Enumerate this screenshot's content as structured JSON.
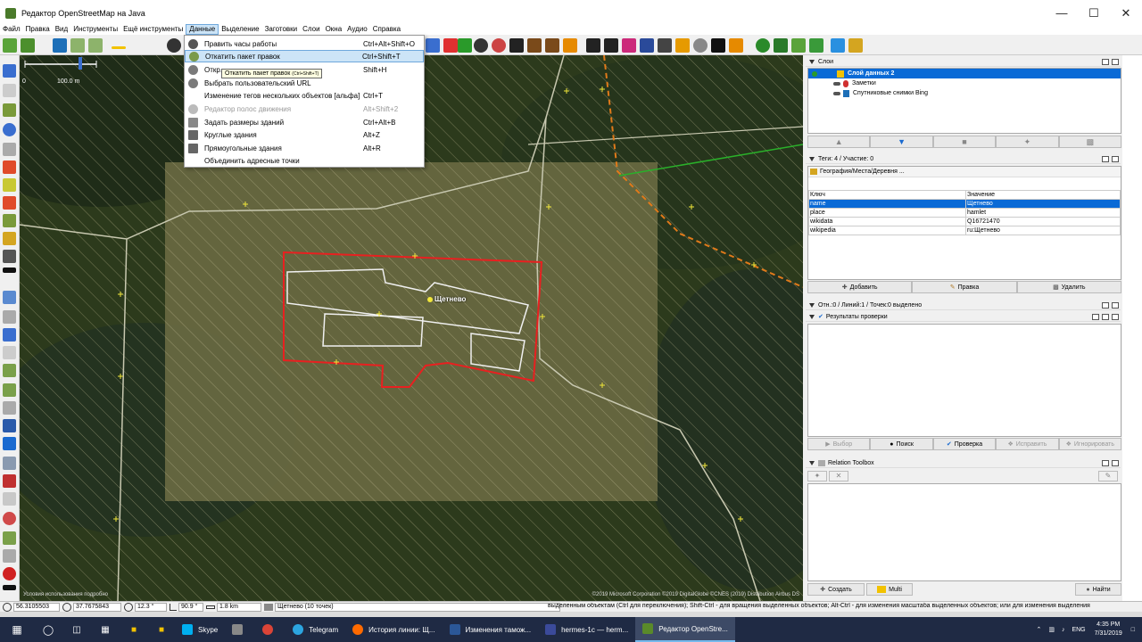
{
  "window": {
    "title": "Редактор OpenStreetMap на Java"
  },
  "menubar": [
    "Файл",
    "Правка",
    "Вид",
    "Инструменты",
    "Ещё инструменты",
    "Данные",
    "Выделение",
    "Заготовки",
    "Слои",
    "Окна",
    "Аудио",
    "Справка"
  ],
  "active_menu": "Данные",
  "dropdown": [
    {
      "label": "Править часы работы",
      "shortcut": "Ctrl+Alt+Shift+O",
      "icon": "clock-icon",
      "disabled": false
    },
    {
      "label": "Откатить пакет правок",
      "shortcut": "Ctrl+Shift+T",
      "icon": "revert-icon",
      "disabled": false,
      "highlighted": true
    },
    {
      "label": "Откр...",
      "shortcut": "Shift+H",
      "icon": "history-icon",
      "disabled": false
    },
    {
      "label": "Выбрать пользовательский URL",
      "shortcut": "",
      "icon": "url-icon",
      "disabled": false
    },
    {
      "label": "Изменение тегов нескольких объектов [альфа]",
      "shortcut": "Ctrl+T",
      "icon": "tags-icon",
      "disabled": false
    },
    {
      "label": "Редактор полос движения",
      "shortcut": "Alt+Shift+2",
      "icon": "lanes-icon",
      "disabled": true
    },
    {
      "label": "Задать размеры зданий",
      "shortcut": "Ctrl+Alt+B",
      "icon": "building-icon",
      "disabled": false
    },
    {
      "label": "Круглые здания",
      "shortcut": "Alt+Z",
      "icon": "circle-building-icon",
      "disabled": false
    },
    {
      "label": "Прямоугольные здания",
      "shortcut": "Alt+R",
      "icon": "rect-building-icon",
      "disabled": false
    },
    {
      "label": "Объединить адресные точки",
      "shortcut": "",
      "icon": "merge-address-icon",
      "disabled": false
    }
  ],
  "tooltip": "Откатить пакет правок",
  "tooltip_shortcut": "(Ctrl+Shift+T)",
  "map": {
    "scale_zero": "0",
    "scale_label": "100.0 m",
    "place_label": "Щетнево",
    "attribution_left": "Условия использования подробно",
    "attribution_right": "©2019 Microsoft Corporation ©2019 DigitalGlobe ©CNES (2019) Distribution Airbus DS"
  },
  "layers_panel": {
    "title": "Слои",
    "layers": [
      {
        "name": "Слой данных 2",
        "selected": true
      },
      {
        "name": "Заметки",
        "selected": false
      },
      {
        "name": "Спутниковые снимки Bing",
        "selected": false
      }
    ]
  },
  "tags_panel": {
    "title": "Теги: 4 / Участие: 0",
    "preset": "География/Места/Деревня ...",
    "col_key": "Ключ",
    "col_value": "Значение",
    "rows": [
      {
        "key": "name",
        "value": "Щетнево",
        "selected": true
      },
      {
        "key": "place",
        "value": "hamlet",
        "selected": false
      },
      {
        "key": "wikidata",
        "value": "Q16721470",
        "selected": false
      },
      {
        "key": "wikipedia",
        "value": "ru:Щетнево",
        "selected": false
      }
    ],
    "buttons": [
      "Добавить",
      "Правка",
      "Удалить"
    ]
  },
  "selection_panel": {
    "title": "Отн.:0 / Линий:1 / Точек:0 выделено"
  },
  "validation_panel": {
    "title": "Результаты проверки",
    "buttons": [
      "Выбор",
      "Поиск",
      "Проверка",
      "Исправить",
      "Игнорировать"
    ]
  },
  "relation_panel": {
    "title": "Relation Toolbox",
    "buttons": [
      "Создать",
      "Multi",
      "Найти"
    ]
  },
  "statusbar": {
    "lat": "56.3105503",
    "lon": "37.7675843",
    "heading": "12.3 °",
    "angle": "90.9 °",
    "distance": "1.8 km",
    "name": "Щетнево (10 точек)",
    "message": "выделенным объектам (Ctrl для переключения); Shift-Ctrl - для вращения выделенных объектов; Alt-Ctrl - для изменения масштаба выделенных объектов; или для изменения выделения"
  },
  "taskbar": {
    "apps": [
      {
        "label": "Skype",
        "color": "#00aff0",
        "active": false
      },
      {
        "label": "Telegram",
        "color": "#2ca5e0",
        "active": false
      },
      {
        "label": "История линии: Щ...",
        "color": "#ff6a00",
        "active": false
      },
      {
        "label": "Изменения тамож...",
        "color": "#2b5797",
        "active": false
      },
      {
        "label": "hermes-1c — herm...",
        "color": "#3b4a9a",
        "active": false
      },
      {
        "label": "Редактор OpenStre...",
        "color": "#5a8a2a",
        "active": true
      }
    ],
    "lang": "ENG",
    "time": "4:35 PM",
    "date": "7/31/2019"
  }
}
